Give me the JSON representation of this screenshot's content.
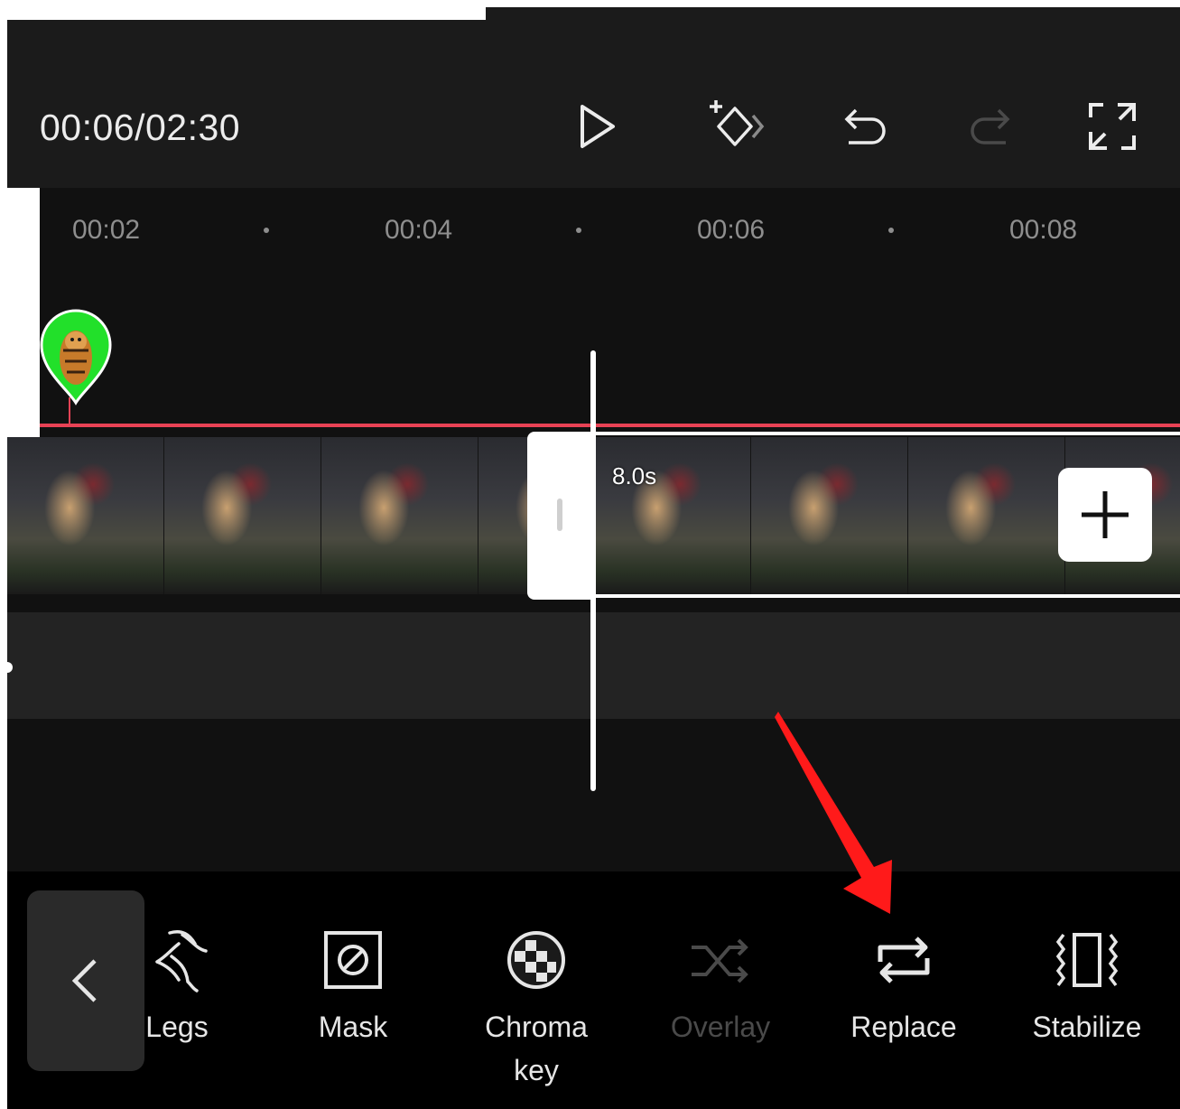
{
  "header": {
    "timecode": "00:06/02:30",
    "buttons": [
      "play-icon",
      "add-keyframe-icon",
      "undo-icon",
      "redo-icon",
      "fullscreen-icon"
    ]
  },
  "ruler": {
    "labels": [
      "00:02",
      "00:04",
      "00:06",
      "00:08"
    ]
  },
  "timeline": {
    "clip_duration": "8.0s",
    "sticker": "tiger-sticker",
    "track_color": "#e84255"
  },
  "toolbar": {
    "back_icon": "chevron-left-icon",
    "tools": [
      {
        "label": "Legs",
        "icon": "legs-icon",
        "enabled": true
      },
      {
        "label": "Mask",
        "icon": "mask-icon",
        "enabled": true
      },
      {
        "label": "Chroma key",
        "icon": "chroma-key-icon",
        "enabled": true
      },
      {
        "label": "Overlay",
        "icon": "overlay-icon",
        "enabled": false
      },
      {
        "label": "Replace",
        "icon": "replace-icon",
        "enabled": true
      },
      {
        "label": "Stabilize",
        "icon": "stabilize-icon",
        "enabled": true
      }
    ]
  },
  "annotation": {
    "arrow_color": "#ff1a1a",
    "points_to": "Replace"
  }
}
